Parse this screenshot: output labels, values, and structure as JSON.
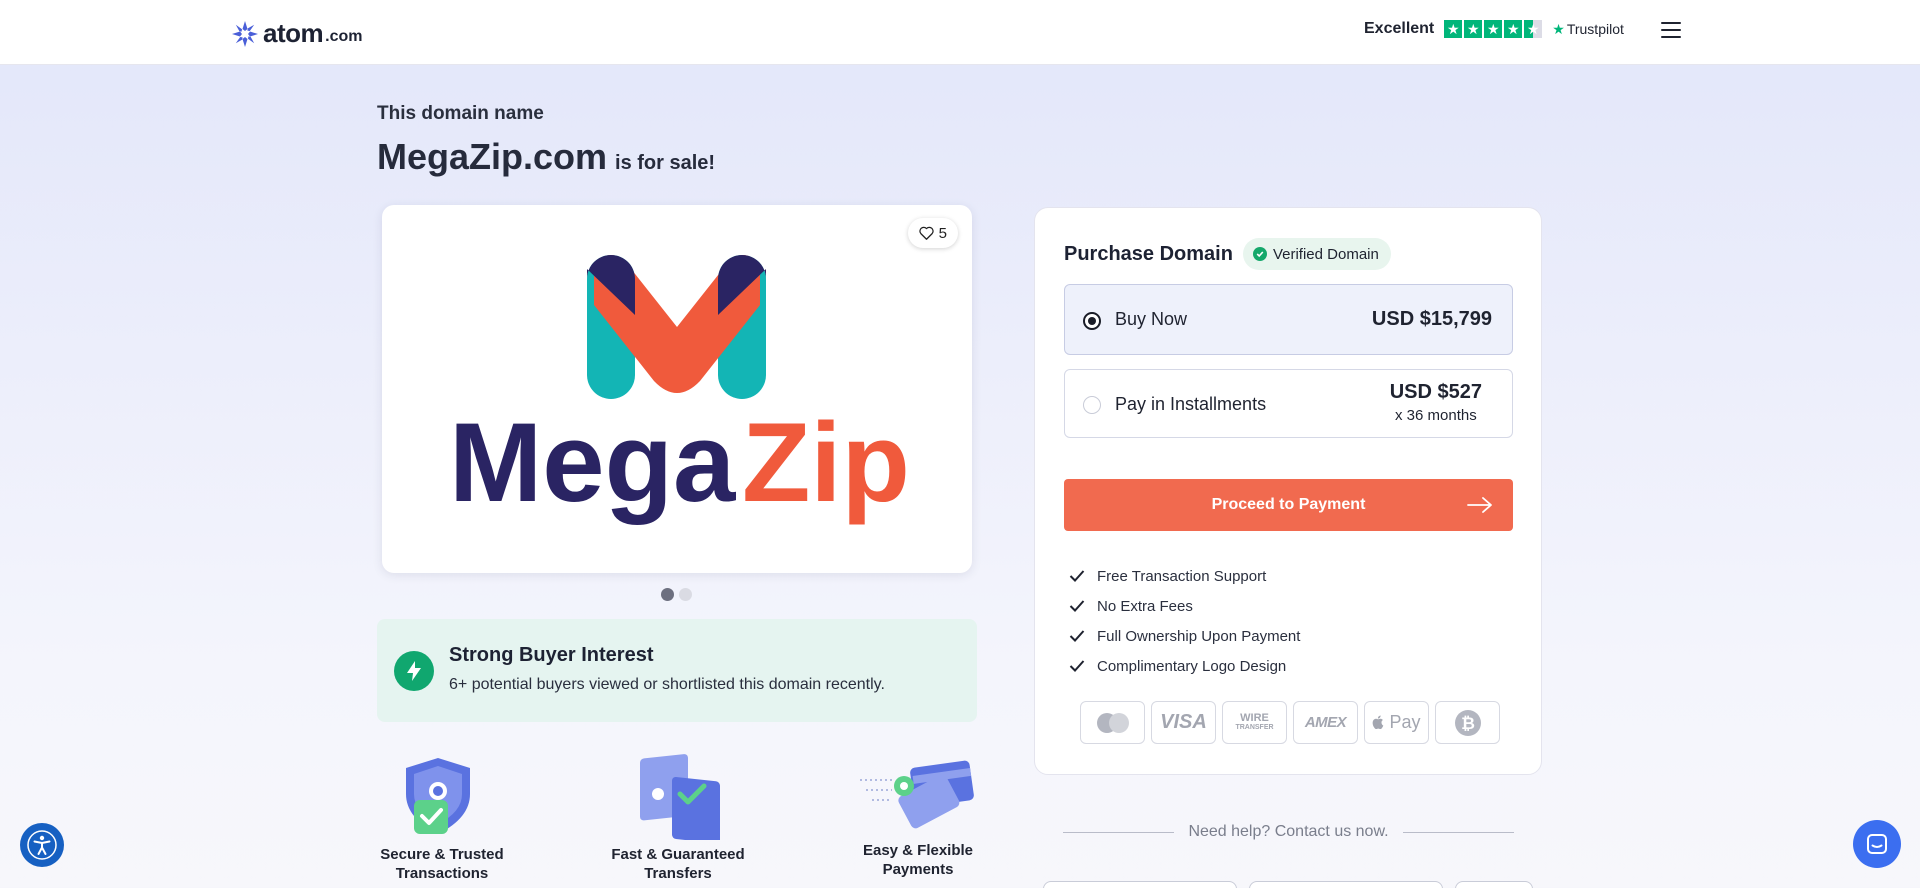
{
  "header": {
    "logo_text": "atom",
    "logo_tld": ".com",
    "rating_label": "Excellent",
    "rating_stars": 4.5,
    "trustpilot_label": "Trustpilot"
  },
  "hero": {
    "eyebrow": "This domain name",
    "domain": "MegaZip.com",
    "for_sale": "is for sale!"
  },
  "logo_card": {
    "likes": "5",
    "brand_word_left": "Mega",
    "brand_word_right": "Zip",
    "slides": 2,
    "active_slide": 1
  },
  "interest": {
    "title": "Strong Buyer Interest",
    "subtitle": "6+ potential buyers viewed or shortlisted this domain recently."
  },
  "features": [
    {
      "line1": "Secure & Trusted",
      "line2": "Transactions"
    },
    {
      "line1": "Fast & Guaranteed",
      "line2": "Transfers"
    },
    {
      "line1": "Easy & Flexible",
      "line2": "Payments"
    }
  ],
  "purchase": {
    "title": "Purchase Domain",
    "verified": "Verified Domain",
    "buy_now_label": "Buy Now",
    "buy_now_price": "USD $15,799",
    "installments_label": "Pay in Installments",
    "installments_price": "USD $527",
    "installments_term": "x 36 months",
    "proceed_label": "Proceed to Payment",
    "benefits": [
      "Free Transaction Support",
      "No Extra Fees",
      "Full Ownership Upon Payment",
      "Complimentary Logo Design"
    ],
    "payment_methods": [
      "mastercard-icon",
      "visa-icon",
      "wire-transfer-icon",
      "amex-icon",
      "apple-pay-icon",
      "bitcoin-icon"
    ],
    "visa_label": "VISA",
    "wire_label_1": "WIRE",
    "wire_label_2": "TRANSFER",
    "amex_label": "AMEX",
    "applepay_label": "Pay"
  },
  "help": {
    "text": "Need help? Contact us now."
  },
  "colors": {
    "accent": "#f16a4f",
    "brand_navy": "#2a2463",
    "brand_teal": "#13b5b5",
    "brand_coral": "#f05a3c",
    "success": "#10a76f"
  }
}
